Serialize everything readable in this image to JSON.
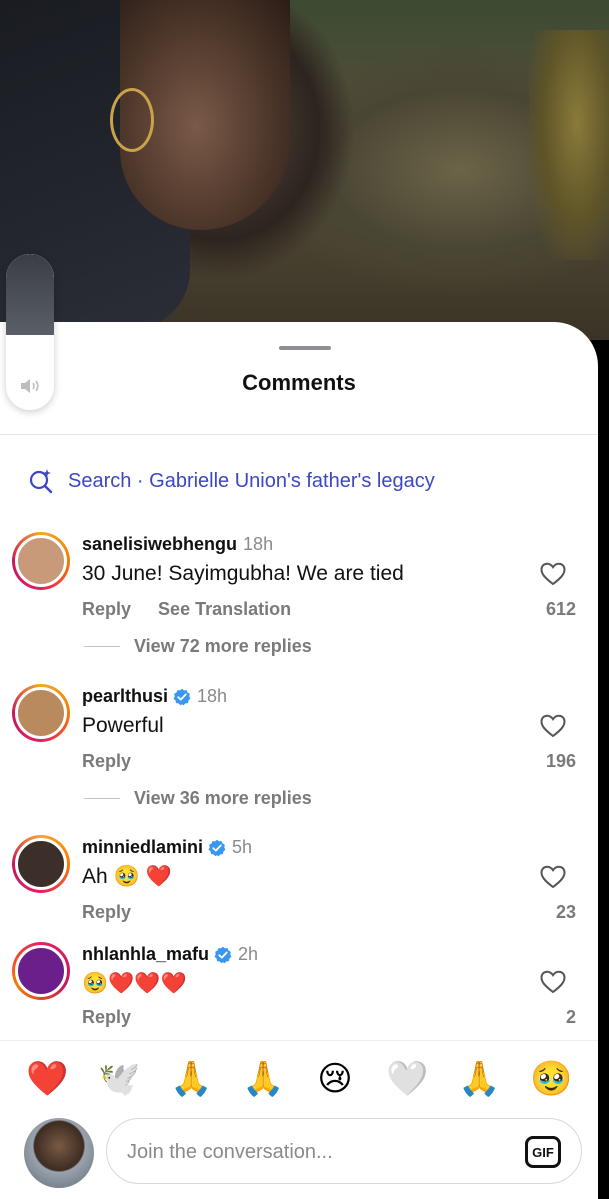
{
  "sheet": {
    "title": "Comments",
    "search_text": "Search · Gabrielle Union's father's legacy"
  },
  "volume": {
    "level": 0.48
  },
  "comments": [
    {
      "username": "sanelisiwebhengu",
      "verified": false,
      "time": "18h",
      "text": "30 June! Sayimgubha! We are tied",
      "reply_label": "Reply",
      "translate_label": "See Translation",
      "likes": "612",
      "view_replies": "View 72 more replies",
      "avatar_color": "#c89a7a"
    },
    {
      "username": "pearlthusi",
      "verified": true,
      "time": "18h",
      "text": "Powerful",
      "reply_label": "Reply",
      "likes": "196",
      "view_replies": "View 36 more replies",
      "avatar_color": "#b98a5e"
    },
    {
      "username": "minniedlamini",
      "verified": true,
      "time": "5h",
      "text": "Ah 🥹 ❤️",
      "reply_label": "Reply",
      "likes": "23",
      "avatar_color": "#3c2f2a"
    },
    {
      "username": "nhlanhla_mafu",
      "verified": true,
      "time": "2h",
      "text": "🥹❤️❤️❤️",
      "reply_label": "Reply",
      "likes": "2",
      "avatar_color": "#6a1f8a"
    }
  ],
  "emoji_bar": [
    "❤️",
    "🕊️",
    "🙏",
    "🙏",
    "😢",
    "🤍",
    "🙏",
    "🥹"
  ],
  "compose": {
    "placeholder": "Join the conversation...",
    "gif_label": "GIF"
  },
  "colors": {
    "link_blue": "#3b47c4",
    "verified_blue": "#3897f0",
    "muted_text": "#7a7a7a"
  }
}
